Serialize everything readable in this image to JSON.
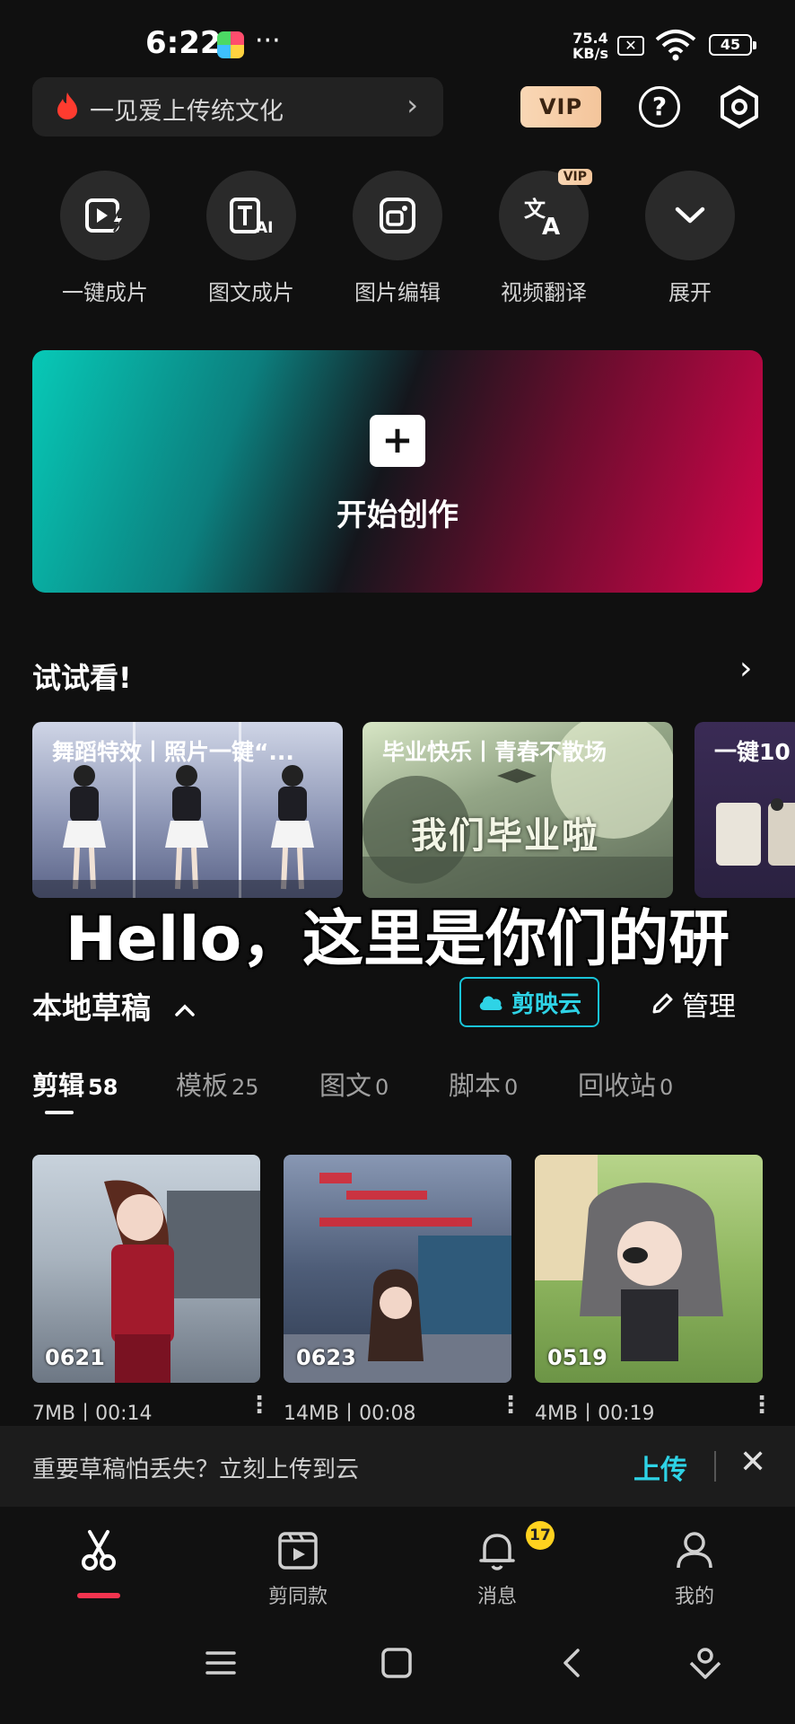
{
  "status": {
    "time": "6:22",
    "dots": "···",
    "net_speed_value": "75.4",
    "net_speed_unit": "KB/s",
    "battery": "45"
  },
  "header": {
    "promo_text": "一见爱上传统文化",
    "vip_label": "VIP",
    "help_label": "?"
  },
  "tools": [
    {
      "label": "一键成片",
      "icon": "magic-video-icon"
    },
    {
      "label": "图文成片",
      "icon": "text-ai-icon"
    },
    {
      "label": "图片编辑",
      "icon": "image-edit-icon"
    },
    {
      "label": "视频翻译",
      "icon": "translate-icon",
      "tag": "VIP"
    },
    {
      "label": "展开",
      "icon": "chevron-down-icon"
    }
  ],
  "create": {
    "plus": "+",
    "label": "开始创作"
  },
  "try": {
    "title": "试试看!",
    "cards": [
      {
        "title": "舞蹈特效丨照片一键“..."
      },
      {
        "title": "毕业快乐丨青春不散场",
        "image_text": "我们毕业啦"
      },
      {
        "title": "一键10"
      }
    ]
  },
  "overlay_subtitle": "Hello，这里是你们的研",
  "drafts": {
    "title": "本地草稿",
    "cloud_label": "剪映云",
    "manage_label": "管理",
    "tabs": [
      {
        "label": "剪辑",
        "count": "58"
      },
      {
        "label": "模板",
        "count": "25"
      },
      {
        "label": "图文",
        "count": "0"
      },
      {
        "label": "脚本",
        "count": "0"
      },
      {
        "label": "回收站",
        "count": "0"
      }
    ],
    "items": [
      {
        "date": "0621",
        "meta": "7MB丨00:14"
      },
      {
        "date": "0623",
        "meta": "14MB丨00:08"
      },
      {
        "date": "0519",
        "meta": "4MB丨00:19"
      }
    ],
    "more": "⋮"
  },
  "upload": {
    "text": "重要草稿怕丢失？立刻上传到云",
    "button": "上传",
    "close": "✕"
  },
  "nav": {
    "items": [
      {
        "label": ""
      },
      {
        "label": "剪同款"
      },
      {
        "label": "消息"
      },
      {
        "label": "我的"
      }
    ],
    "badge": "17"
  },
  "colors": {
    "accent_cyan": "#2ed3e6",
    "accent_red": "#f2344f",
    "vip_gold": "#f4c59b",
    "background": "#101010"
  }
}
